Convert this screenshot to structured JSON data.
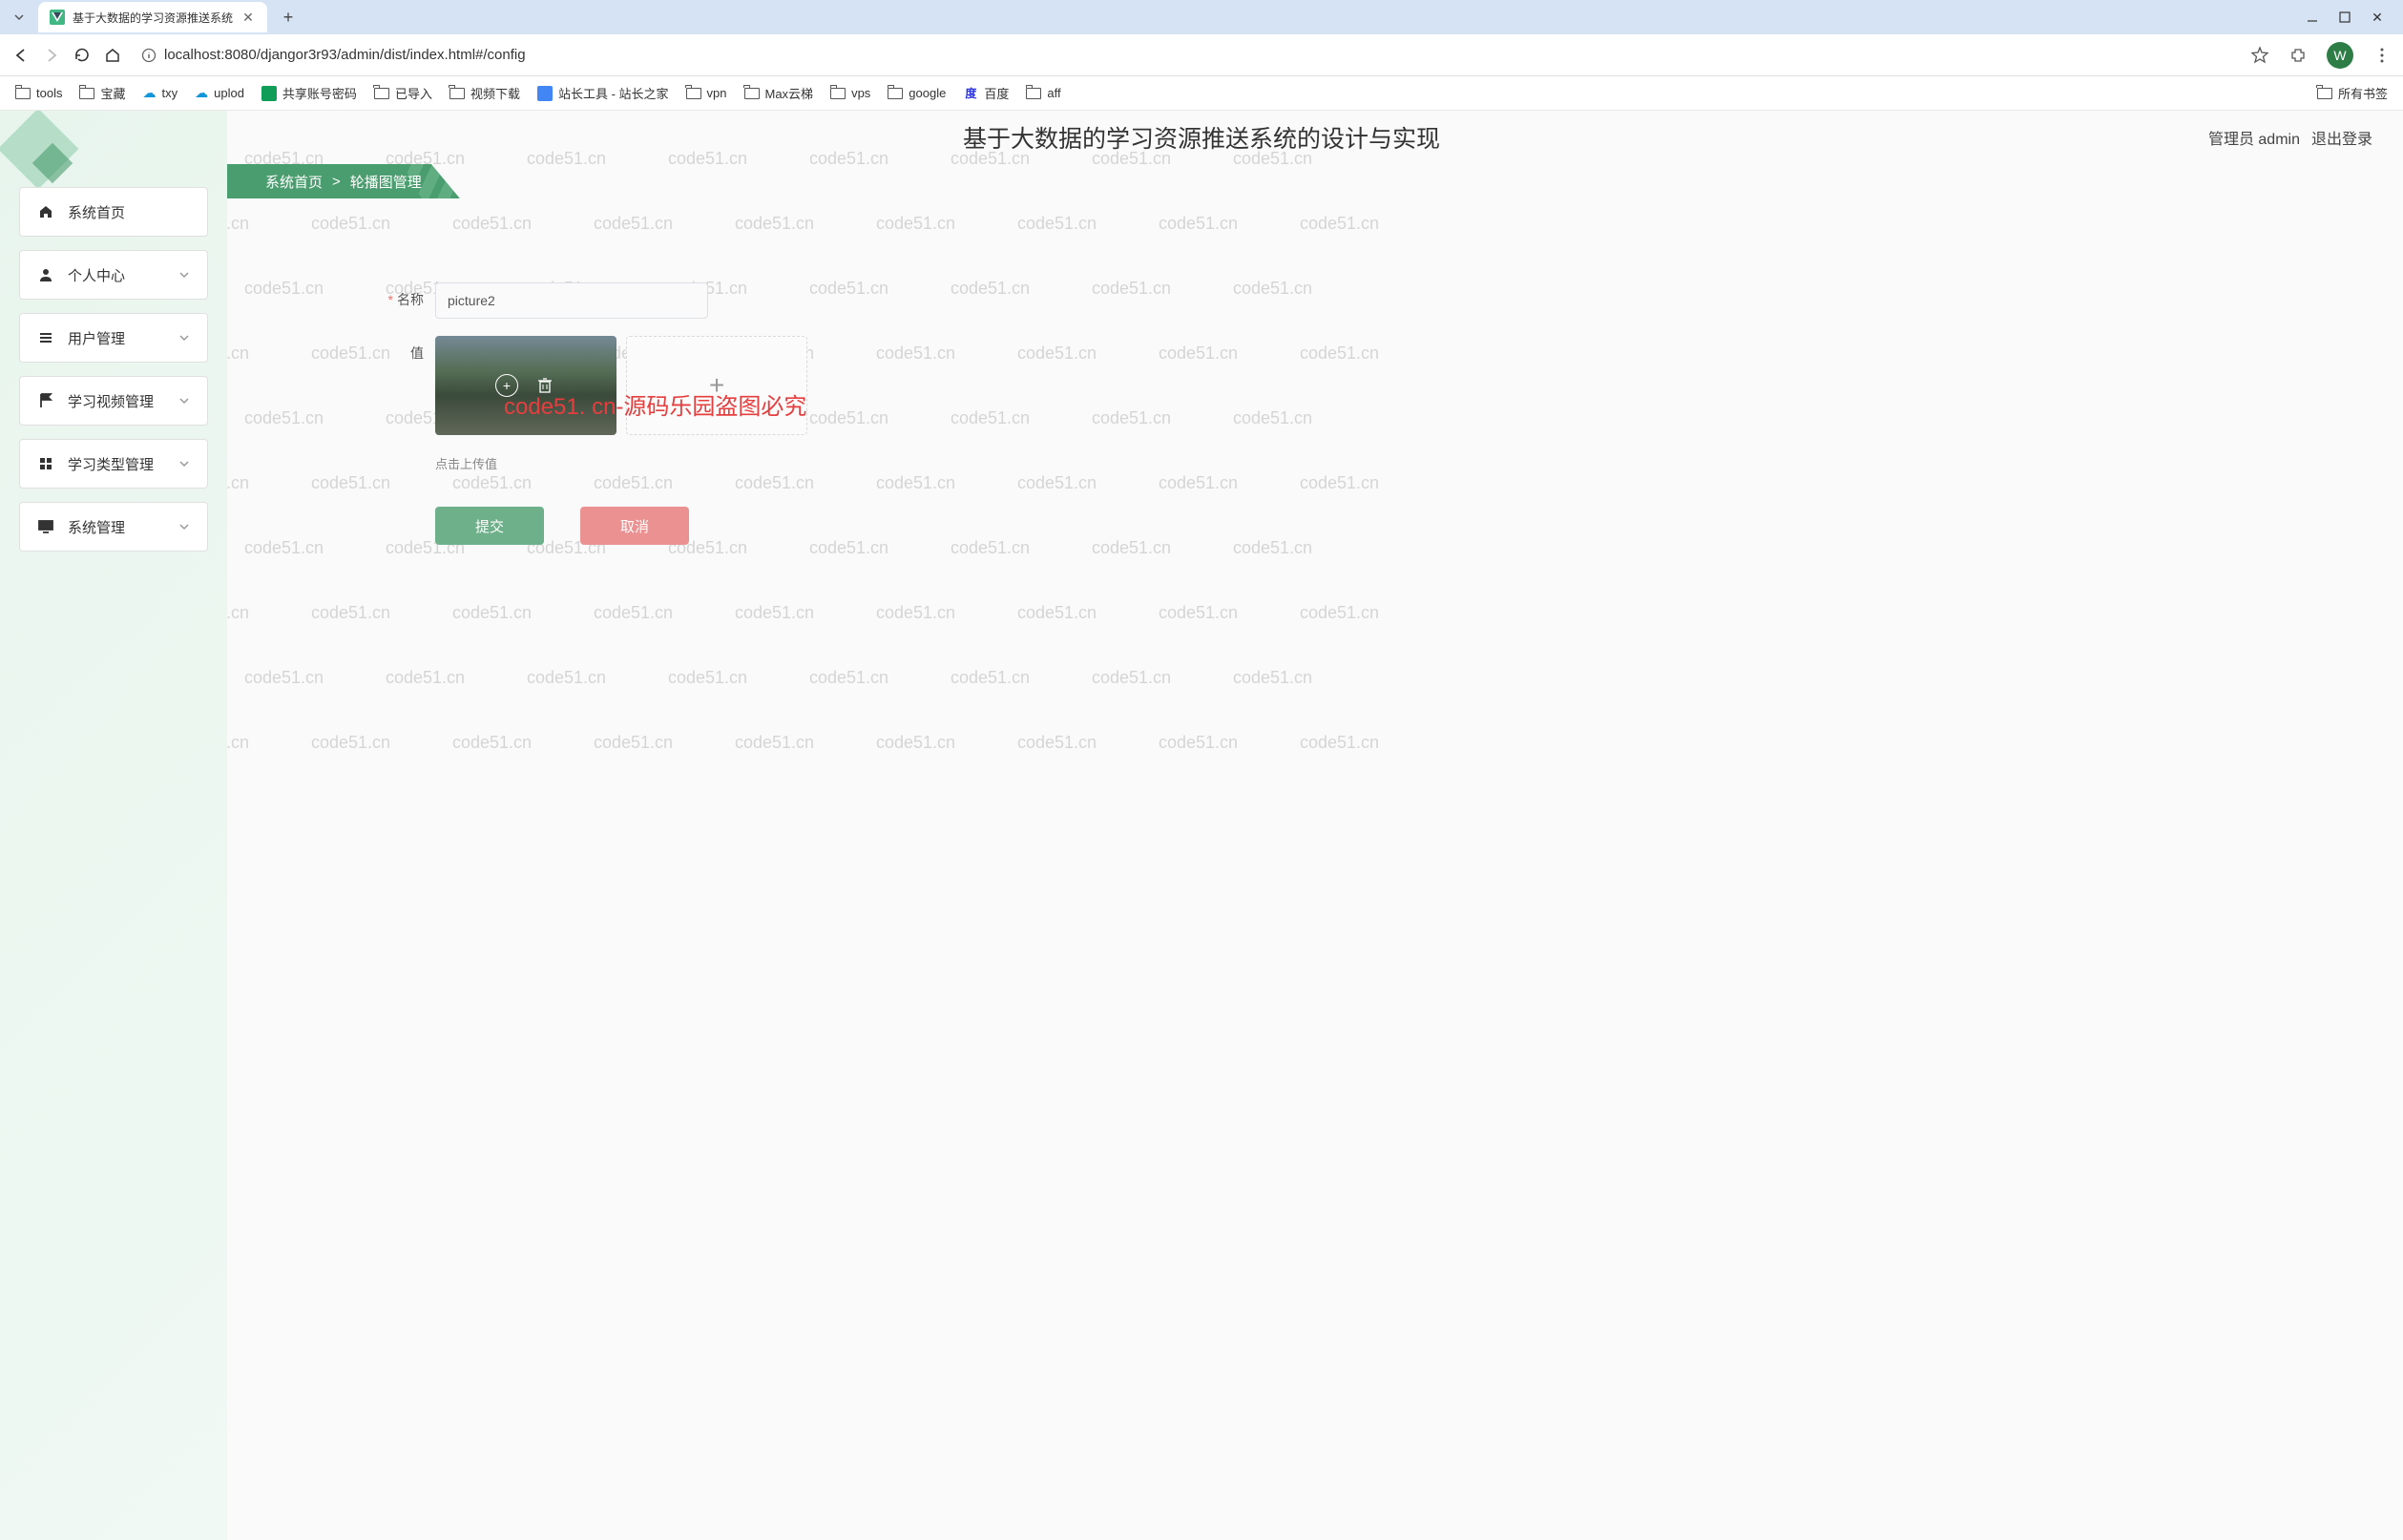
{
  "browser": {
    "tab": {
      "title": "基于大数据的学习资源推送系统"
    },
    "url": "localhost:8080/djangor3r93/admin/dist/index.html#/config",
    "profile_initial": "W",
    "bookmarks": [
      {
        "type": "folder",
        "label": "tools"
      },
      {
        "type": "folder",
        "label": "宝藏"
      },
      {
        "type": "cloud",
        "label": "txy"
      },
      {
        "type": "cloud",
        "label": "uplod"
      },
      {
        "type": "sheet",
        "label": "共享账号密码"
      },
      {
        "type": "folder",
        "label": "已导入"
      },
      {
        "type": "folder",
        "label": "视频下载"
      },
      {
        "type": "site1",
        "label": "站长工具 - 站长之家"
      },
      {
        "type": "folder",
        "label": "vpn"
      },
      {
        "type": "folder",
        "label": "Max云梯"
      },
      {
        "type": "folder",
        "label": "vps"
      },
      {
        "type": "folder",
        "label": "google"
      },
      {
        "type": "site2",
        "label": "百度"
      },
      {
        "type": "folder",
        "label": "aff"
      }
    ],
    "bookmarks_right": {
      "label": "所有书签"
    }
  },
  "header": {
    "title": "基于大数据的学习资源推送系统的设计与实现",
    "admin": "管理员 admin",
    "logout": "退出登录"
  },
  "breadcrumb": {
    "home": "系统首页",
    "sep": ">",
    "current": "轮播图管理"
  },
  "sidebar": {
    "items": [
      {
        "label": "系统首页",
        "icon": "home",
        "expandable": false
      },
      {
        "label": "个人中心",
        "icon": "person",
        "expandable": true
      },
      {
        "label": "用户管理",
        "icon": "list",
        "expandable": true
      },
      {
        "label": "学习视频管理",
        "icon": "flag",
        "expandable": true
      },
      {
        "label": "学习类型管理",
        "icon": "grid",
        "expandable": true
      },
      {
        "label": "系统管理",
        "icon": "monitor",
        "expandable": true
      }
    ]
  },
  "form": {
    "name_label": "名称",
    "name_value": "picture2",
    "value_label": "值",
    "upload_hint": "点击上传值",
    "submit": "提交",
    "cancel": "取消"
  },
  "watermark": {
    "text": "code51.cn",
    "red_text": "code51. cn-源码乐园盗图必究"
  }
}
